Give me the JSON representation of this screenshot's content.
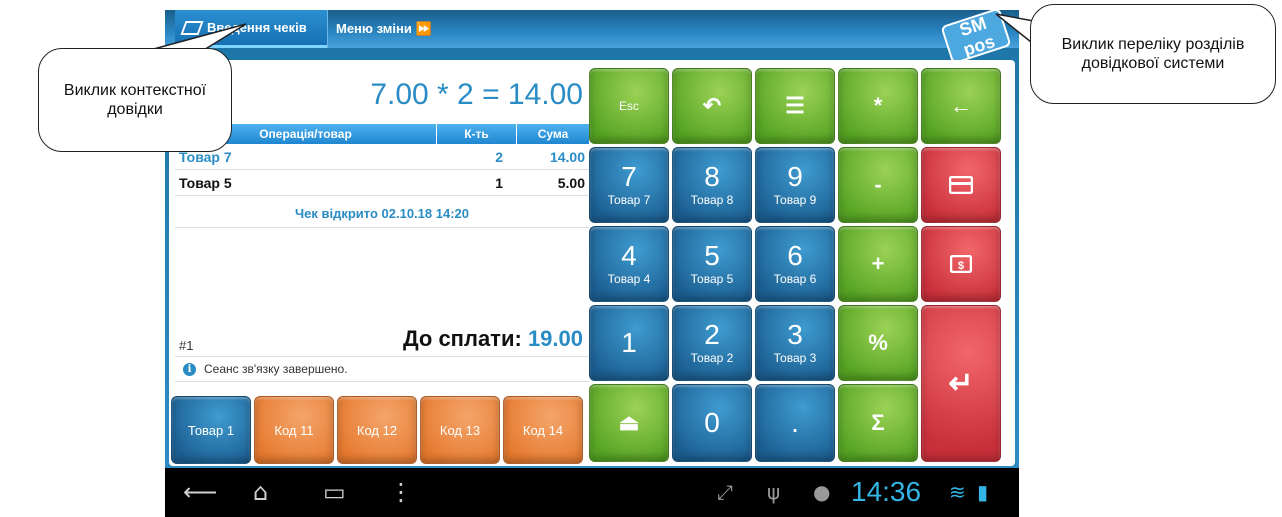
{
  "topbar": {
    "tab_checks": "Введення чеків",
    "tab_shift": "Меню зміни ⏩",
    "logo": "SM pos"
  },
  "receipt": {
    "calc": "7.00 * 2 = 14.00",
    "columns": [
      "Операція/товар",
      "К-ть",
      "Сума"
    ],
    "rows": [
      {
        "name": "Товар 7",
        "qty": "2",
        "sum": "14.00"
      },
      {
        "name": "Товар 5",
        "qty": "1",
        "sum": "5.00"
      }
    ],
    "check_open": "Чек відкрито 02.10.18 14:20",
    "number": "#1",
    "total_label": "До сплати:",
    "total_value": "19.00",
    "status": "Сеанс зв'язку завершено."
  },
  "quick_buttons": [
    "Товар 1",
    "Код 11",
    "Код 12",
    "Код 13",
    "Код 14"
  ],
  "keypad": {
    "row1": [
      "Esc",
      "↶",
      "☰",
      "*",
      "←"
    ],
    "digits": [
      {
        "d": "7",
        "p": "Товар 7"
      },
      {
        "d": "8",
        "p": "Товар 8"
      },
      {
        "d": "9",
        "p": "Товар 9"
      },
      {
        "d": "4",
        "p": "Товар 4"
      },
      {
        "d": "5",
        "p": "Товар 5"
      },
      {
        "d": "6",
        "p": "Товар 6"
      },
      {
        "d": "1",
        "p": ""
      },
      {
        "d": "2",
        "p": "Товар 2"
      },
      {
        "d": "3",
        "p": "Товар 3"
      }
    ],
    "ops": [
      "-",
      "+",
      "%",
      "Σ"
    ],
    "bottom": [
      "⏏",
      "0",
      "."
    ],
    "enter": "↵"
  },
  "navbar": {
    "clock": "14:36"
  },
  "callouts": {
    "left": "Виклик контекстної довідки",
    "right": "Виклик переліку розділів довідкової системи"
  },
  "colors": {
    "accent": "#2a8cc4",
    "key_blue": "#1c5f92",
    "key_green": "#55a323",
    "key_red": "#c9303a",
    "key_orange": "#e67a2f"
  }
}
